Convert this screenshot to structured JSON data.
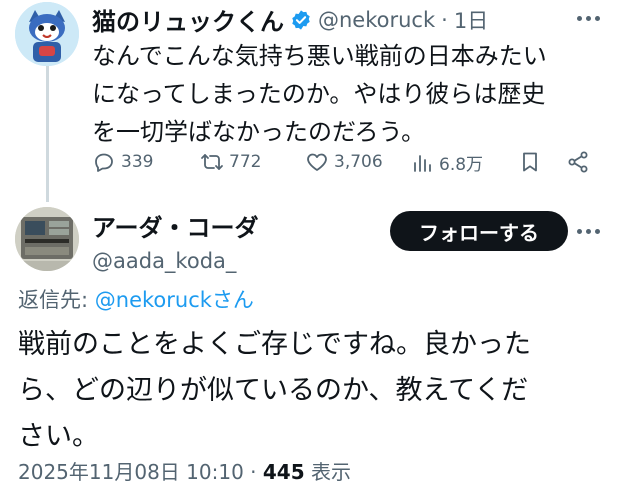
{
  "original_tweet": {
    "display_name": "猫のリュックくん",
    "handle": "@nekoruck",
    "separator": "·",
    "time_ago": "1日",
    "text_lines": [
      "なんでこんな気持ち悪い戦前の日本みたい",
      "になってしまったのか。やはり彼らは歴史",
      "を一切学ばなかったのだろう。"
    ],
    "stats": {
      "replies": "339",
      "reposts": "772",
      "likes": "3,706",
      "views": "6.8万"
    }
  },
  "reply_tweet": {
    "display_name": "アーダ・コーダ",
    "handle": "@aada_koda_",
    "follow_label": "フォローする",
    "replying_to_prefix": "返信先: ",
    "replying_to_handle": "@nekoruck",
    "replying_to_suffix": "さん",
    "text_lines": [
      "戦前のことをよくご存じですね。良かった",
      "ら、どの辺りが似ているのか、教えてくだ",
      "さい。"
    ],
    "timestamp": "2025年11月08日 10:10",
    "separator": "·",
    "view_count": "445",
    "view_label": "表示"
  },
  "colors": {
    "accent": "#1d9bf0",
    "muted": "#536471",
    "verified": "#1d9bf0",
    "button_bg": "#0f1419"
  }
}
